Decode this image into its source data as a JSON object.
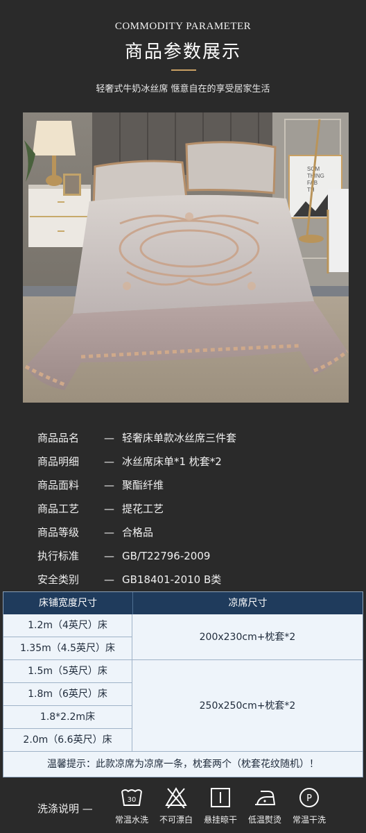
{
  "header": {
    "en_title": "COMMODITY PARAMETER",
    "cn_title": "商品参数展示",
    "subtitle": "轻奢式牛奶冰丝席 惬意自在的享受居家生活"
  },
  "photo": {
    "sign_text_1": "SOM",
    "sign_text_2": "THING",
    "sign_text_3": "FAB",
    "sign_text_4": "TH"
  },
  "params": [
    {
      "key": "商品品名",
      "dash": "—",
      "value": "轻奢床单款冰丝席三件套"
    },
    {
      "key": "商品明细",
      "dash": "—",
      "value": "冰丝席床单*1  枕套*2"
    },
    {
      "key": "商品面料",
      "dash": "—",
      "value": "聚酯纤维"
    },
    {
      "key": "商品工艺",
      "dash": "—",
      "value": "提花工艺"
    },
    {
      "key": "商品等级",
      "dash": "—",
      "value": "合格品"
    },
    {
      "key": "执行标准",
      "dash": "—",
      "value": "GB/T22796-2009"
    },
    {
      "key": "安全类别",
      "dash": "—",
      "value": "GB18401-2010 B类"
    }
  ],
  "size_table": {
    "headers": [
      "床铺宽度尺寸",
      "凉席尺寸"
    ],
    "rows": [
      "1.2m（4英尺）床",
      "1.35m（4.5英尺）床",
      "1.5m（5英尺）床",
      "1.8m（6英尺）床",
      "1.8*2.2m床",
      "2.0m（6.6英尺）床"
    ],
    "size_a": "200x230cm+枕套*2",
    "size_b": "250x250cm+枕套*2",
    "note": "温馨提示：此款凉席为凉席一条，枕套两个（枕套花纹随机）！"
  },
  "wash": {
    "title": "洗涤说明  —",
    "icon_30": "30",
    "icon_p": "P",
    "items": [
      {
        "icon": "wash-30-icon",
        "label": "常温水洗"
      },
      {
        "icon": "no-bleach-icon",
        "label": "不可漂白"
      },
      {
        "icon": "hang-dry-icon",
        "label": "悬挂晾干"
      },
      {
        "icon": "low-iron-icon",
        "label": "低温熨烫"
      },
      {
        "icon": "dry-clean-icon",
        "label": "常温干洗"
      }
    ]
  },
  "colors": {
    "background": "#2a2a2a",
    "gold": "#c9a063",
    "table_header": "#1f3b5c",
    "table_body": "#eef4fa"
  }
}
